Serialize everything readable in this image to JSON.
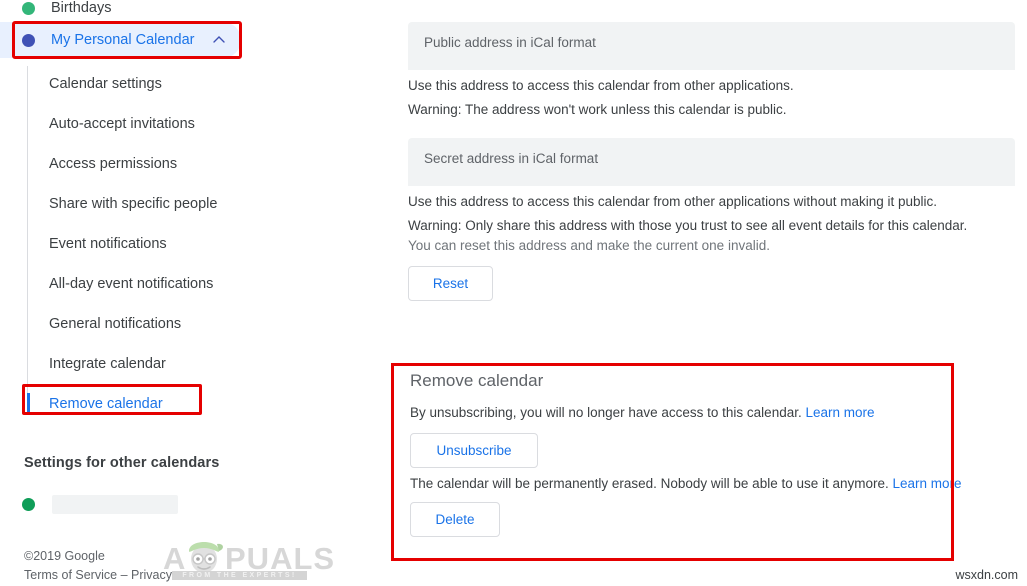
{
  "sidebar": {
    "calendars": [
      {
        "name": "Birthdays",
        "dot_color": "#33b679",
        "selected": false
      },
      {
        "name": "My Personal Calendar",
        "dot_color": "#3f51b5",
        "selected": true,
        "chevron": "chevron-up-icon"
      }
    ],
    "submenu": [
      {
        "label": "Calendar settings",
        "active": false
      },
      {
        "label": "Auto-accept invitations",
        "active": false
      },
      {
        "label": "Access permissions",
        "active": false
      },
      {
        "label": "Share with specific people",
        "active": false
      },
      {
        "label": "Event notifications",
        "active": false
      },
      {
        "label": "All-day event notifications",
        "active": false
      },
      {
        "label": "General notifications",
        "active": false
      },
      {
        "label": "Integrate calendar",
        "active": false
      },
      {
        "label": "Remove calendar",
        "active": true
      }
    ],
    "other_calendars_heading": "Settings for other calendars",
    "other_calendar_dot_color": "#0f9d58",
    "footer": {
      "copyright": "©2019 Google",
      "terms": "Terms of Service",
      "separator": " – ",
      "privacy": "Privacy"
    }
  },
  "content": {
    "public_address": {
      "placeholder": "Public address in iCal format",
      "help": "Use this address to access this calendar from other applications.",
      "warning": "Warning: The address won't work unless this calendar is public."
    },
    "secret_address": {
      "placeholder": "Secret address in iCal format",
      "help": "Use this address to access this calendar from other applications without making it public.",
      "warning": "Warning: Only share this address with those you trust to see all event details for this calendar.",
      "note": "You can reset this address and make the current one invalid.",
      "reset_label": "Reset"
    },
    "remove_calendar": {
      "title": "Remove calendar",
      "unsubscribe_text": "By unsubscribing, you will no longer have access to this calendar.",
      "unsubscribe_learn_more": "Learn more",
      "unsubscribe_label": "Unsubscribe",
      "delete_text": "The calendar will be permanently erased. Nobody will be able to use it anymore.",
      "delete_learn_more": "Learn more",
      "delete_label": "Delete"
    }
  },
  "annotations": {
    "highlight_color": "#e50000",
    "boxes": [
      "my-personal-calendar",
      "remove-calendar-item",
      "remove-calendar-panel"
    ]
  },
  "watermarks": {
    "appuals_main": "PUALS",
    "appuals_tagline": "FROM THE EXPERTS!",
    "site": "wsxdn.com"
  },
  "colors": {
    "accent_blue": "#1a73e8",
    "selected_bg": "#e8f0fe",
    "field_bg": "#f1f3f4",
    "text": "#3c4043",
    "muted": "#70757a"
  }
}
